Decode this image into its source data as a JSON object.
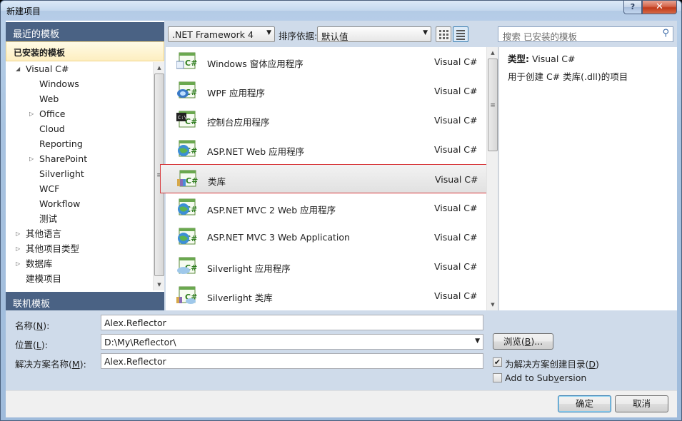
{
  "window": {
    "title": "新建项目",
    "help_label": "?",
    "close_label": "✕"
  },
  "left_pane": {
    "recent_header": "最近的模板",
    "installed_header": "已安装的模板",
    "online_header": "联机模板",
    "tree": [
      {
        "label": "Visual C#",
        "level": 0,
        "expander": "expanded"
      },
      {
        "label": "Windows",
        "level": 1,
        "expander": "none"
      },
      {
        "label": "Web",
        "level": 1,
        "expander": "none"
      },
      {
        "label": "Office",
        "level": 1,
        "expander": "collapsed"
      },
      {
        "label": "Cloud",
        "level": 1,
        "expander": "none"
      },
      {
        "label": "Reporting",
        "level": 1,
        "expander": "none"
      },
      {
        "label": "SharePoint",
        "level": 1,
        "expander": "collapsed"
      },
      {
        "label": "Silverlight",
        "level": 1,
        "expander": "none"
      },
      {
        "label": "WCF",
        "level": 1,
        "expander": "none"
      },
      {
        "label": "Workflow",
        "level": 1,
        "expander": "none"
      },
      {
        "label": "测试",
        "level": 1,
        "expander": "none"
      },
      {
        "label": "其他语言",
        "level": 0,
        "expander": "collapsed"
      },
      {
        "label": "其他项目类型",
        "level": 0,
        "expander": "collapsed"
      },
      {
        "label": "数据库",
        "level": 0,
        "expander": "collapsed"
      },
      {
        "label": "建模项目",
        "level": 0,
        "expander": "none"
      }
    ]
  },
  "toolbar": {
    "framework": ".NET Framework 4",
    "sort_label": "排序依据:",
    "sort_value": "默认值",
    "search_placeholder": "搜索 已安装的模板",
    "search_icon": "search-icon"
  },
  "templates": [
    {
      "name": "Windows 窗体应用程序",
      "lang": "Visual C#",
      "icon": "winforms-icon",
      "selected": false
    },
    {
      "name": "WPF 应用程序",
      "lang": "Visual C#",
      "icon": "wpf-icon",
      "selected": false
    },
    {
      "name": "控制台应用程序",
      "lang": "Visual C#",
      "icon": "console-icon",
      "selected": false
    },
    {
      "name": "ASP.NET Web 应用程序",
      "lang": "Visual C#",
      "icon": "web-app-icon",
      "selected": false
    },
    {
      "name": "类库",
      "lang": "Visual C#",
      "icon": "class-library-icon",
      "selected": true
    },
    {
      "name": "ASP.NET MVC 2 Web 应用程序",
      "lang": "Visual C#",
      "icon": "web-app-icon",
      "selected": false
    },
    {
      "name": "ASP.NET MVC 3 Web Application",
      "lang": "Visual C#",
      "icon": "web-app-icon",
      "selected": false
    },
    {
      "name": "Silverlight 应用程序",
      "lang": "Visual C#",
      "icon": "silverlight-icon",
      "selected": false
    },
    {
      "name": "Silverlight 类库",
      "lang": "Visual C#",
      "icon": "silverlight-library-icon",
      "selected": false
    }
  ],
  "description": {
    "type_label": "类型:",
    "type_value": "Visual C#",
    "text": "用于创建 C# 类库(.dll)的项目"
  },
  "form": {
    "name_label_pre": "名称(",
    "name_label_key": "N",
    "name_label_post": "):",
    "name_value": "Alex.Reflector",
    "location_label_pre": "位置(",
    "location_label_key": "L",
    "location_label_post": "):",
    "location_value": "D:\\My\\Reflector\\",
    "solution_label_pre": "解决方案名称(",
    "solution_label_key": "M",
    "solution_label_post": "):",
    "solution_value": "Alex.Reflector",
    "browse_pre": "浏览(",
    "browse_key": "B",
    "browse_post": ")...",
    "create_dir_pre": "为解决方案创建目录(",
    "create_dir_key": "D",
    "create_dir_post": ")",
    "create_dir_checked": true,
    "svn_pre": "Add to Sub",
    "svn_key": "v",
    "svn_post": "ersion",
    "svn_checked": false
  },
  "buttons": {
    "ok": "确定",
    "cancel": "取消"
  }
}
